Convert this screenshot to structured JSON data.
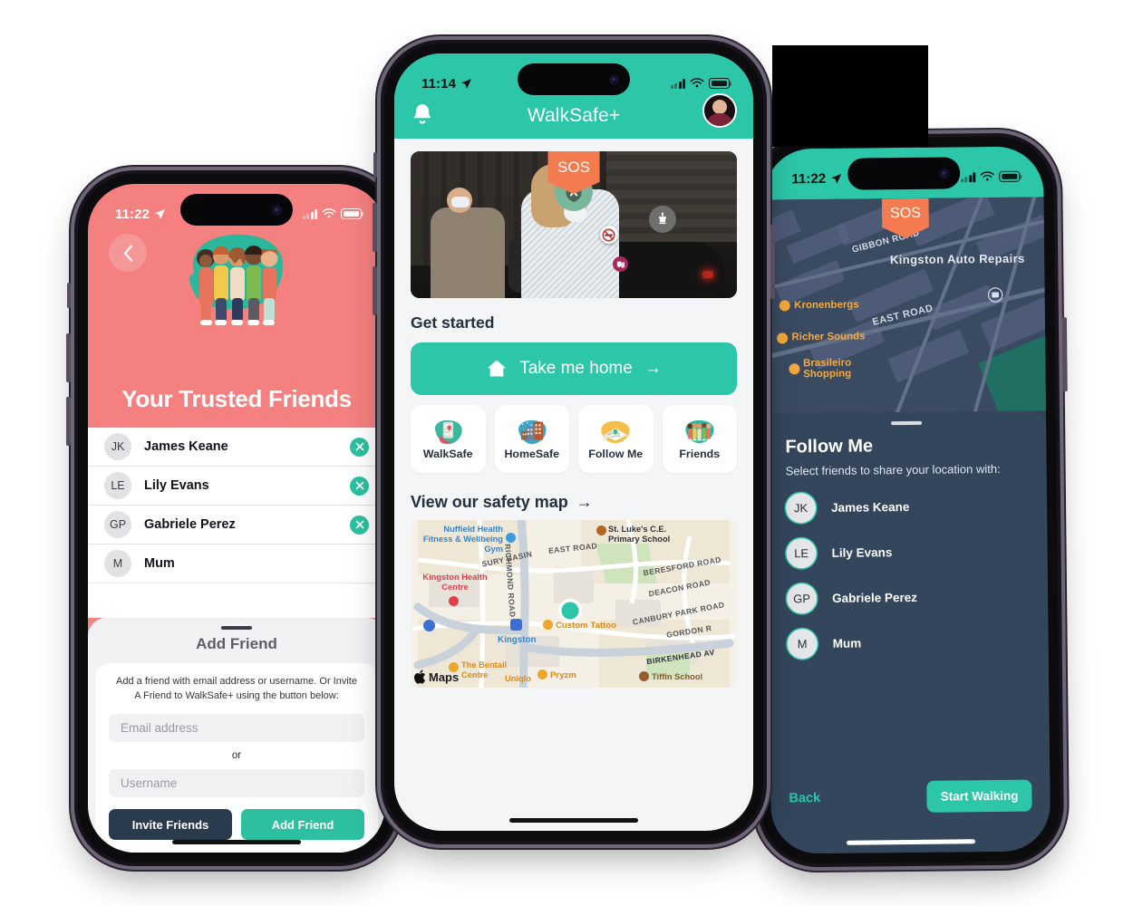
{
  "left_phone": {
    "status": {
      "time": "11:22",
      "location_icon": "location-arrow-icon"
    },
    "back_label": "‹",
    "title": "Your Trusted Friends",
    "illustration": "group-of-friends-illustration",
    "friends": [
      {
        "initials": "JK",
        "name": "James Keane",
        "removable": true
      },
      {
        "initials": "LE",
        "name": "Lily Evans",
        "removable": true
      },
      {
        "initials": "GP",
        "name": "Gabriele Perez",
        "removable": true
      },
      {
        "initials": "M",
        "name": "Mum",
        "removable": false
      }
    ],
    "sheet": {
      "title": "Add Friend",
      "description": "Add a friend with email address or username. Or Invite A Friend to WalkSafe+ using the button below:",
      "email_placeholder": "Email address",
      "or_label": "or",
      "username_placeholder": "Username",
      "invite_label": "Invite Friends",
      "add_label": "Add Friend"
    }
  },
  "center_phone": {
    "status": {
      "time": "11:14",
      "location_icon": "location-arrow-icon"
    },
    "app_title": "WalkSafe+",
    "bell_icon": "bell-icon",
    "avatar": "user-avatar",
    "sos_label": "SOS",
    "hero_pins": [
      "shield-x-icon",
      "street-lamp-icon",
      "no-smoking-icon",
      "theatre-masks-icon"
    ],
    "get_started_title": "Get started",
    "cta_label": "Take me home",
    "cta_icon": "home-icon",
    "cta_arrow": "→",
    "tiles": [
      {
        "label": "WalkSafe",
        "icon": "phone-in-hand-illustration"
      },
      {
        "label": "HomeSafe",
        "icon": "city-buildings-illustration"
      },
      {
        "label": "Follow Me",
        "icon": "open-map-illustration"
      },
      {
        "label": "Friends",
        "icon": "group-of-friends-illustration"
      }
    ],
    "map_link_label": "View our safety map",
    "map_link_arrow": "→",
    "map_labels": {
      "attribution": "Maps",
      "places": [
        "Nuffield Health Fitness & Wellbeing Gym",
        "St. Luke's C.E. Primary School",
        "Kingston Health Centre",
        "Custom Tattoo",
        "Kingston",
        "The Bentall Centre",
        "Uniqlo",
        "Pryzm",
        "Tiffin School"
      ],
      "roads": [
        "SURY BASIN",
        "RICHMOND ROAD",
        "EAST ROAD",
        "BERESFORD ROAD",
        "DEACON ROAD",
        "CANBURY PARK ROAD",
        "GORDON R",
        "BIRKENHEAD AV"
      ]
    }
  },
  "right_phone": {
    "status": {
      "time": "11:22",
      "location_icon": "location-arrow-icon"
    },
    "sos_label": "SOS",
    "map_pois": [
      {
        "name": "Kronenbergs",
        "icon": "shop-icon"
      },
      {
        "name": "Richer Sounds",
        "icon": "shop-icon"
      },
      {
        "name": "Brasileiro Shopping",
        "icon": "restaurant-icon"
      }
    ],
    "map_places": [
      {
        "name": "Kingston Auto Repairs",
        "icon": "car-repair-icon"
      }
    ],
    "map_roads": [
      "GIBBON ROAD",
      "EAST ROAD"
    ],
    "sheet": {
      "title": "Follow Me",
      "subtitle": "Select friends to share your location with:",
      "friends": [
        {
          "initials": "JK",
          "name": "James Keane"
        },
        {
          "initials": "LE",
          "name": "Lily Evans"
        },
        {
          "initials": "GP",
          "name": "Gabriele Perez"
        },
        {
          "initials": "M",
          "name": "Mum"
        }
      ],
      "back_label": "Back",
      "start_label": "Start Walking"
    }
  },
  "colors": {
    "teal": "#2CC6A8",
    "teal_dark": "#2CC0A0",
    "coral": "#F48080",
    "orange": "#F37B4F",
    "navy": "#2B3B4E",
    "slate": "#33465C",
    "page_bg": "#FFFFFF"
  }
}
